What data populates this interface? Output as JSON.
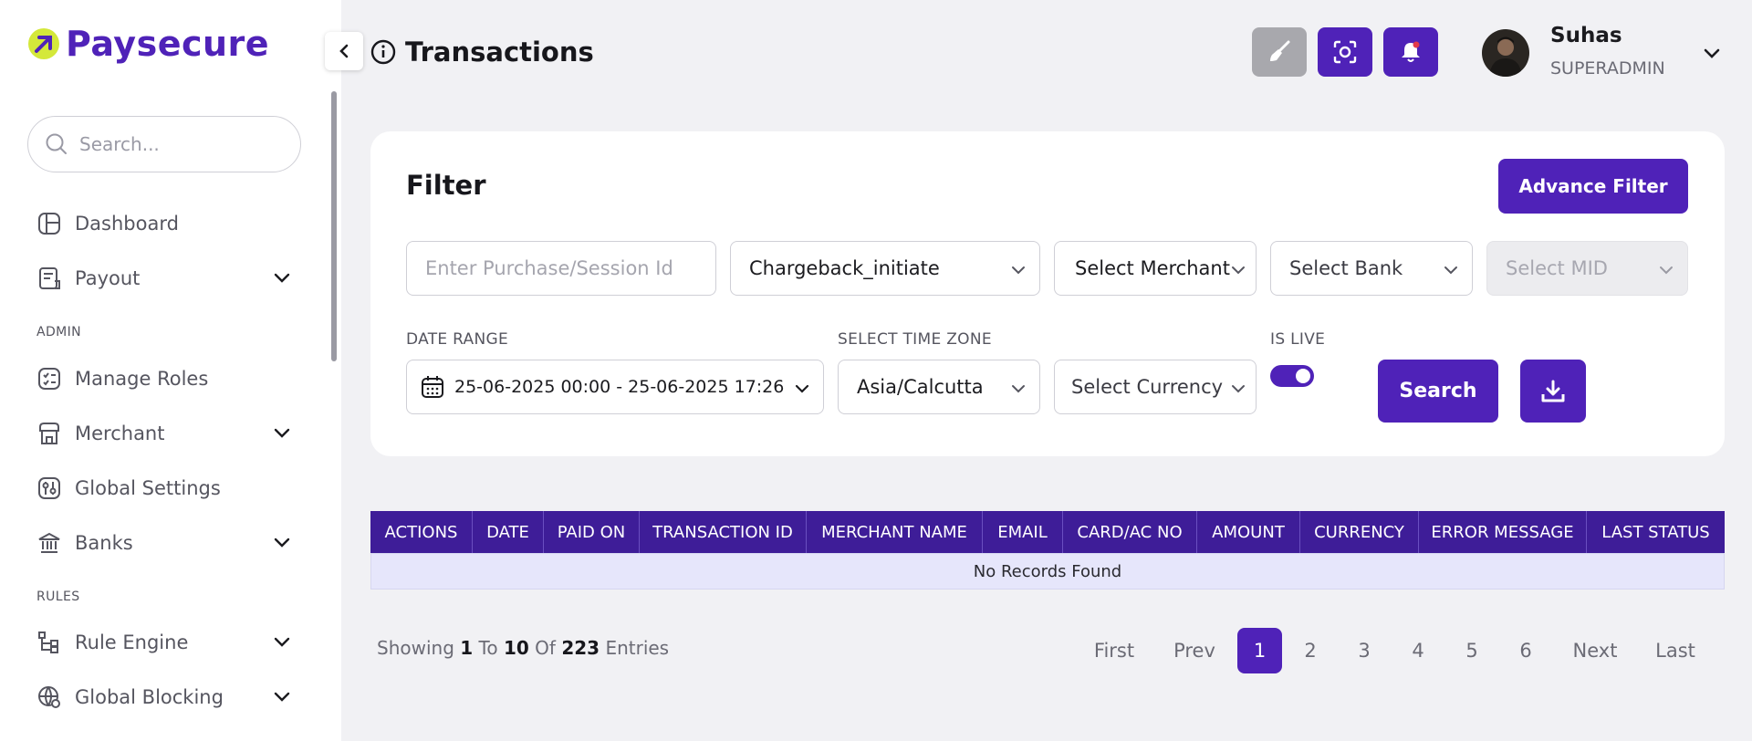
{
  "brand": {
    "name": "Paysecure",
    "accent": "#4f22b8",
    "logo_mark_color": "#d4e83a"
  },
  "sidebar": {
    "search_placeholder": "Search...",
    "items": [
      {
        "label": "Dashboard",
        "icon": "dashboard-icon",
        "expandable": false
      },
      {
        "label": "Payout",
        "icon": "payout-icon",
        "expandable": true
      },
      {
        "label": "Manage Roles",
        "icon": "roles-icon",
        "expandable": false
      },
      {
        "label": "Merchant",
        "icon": "merchant-icon",
        "expandable": true
      },
      {
        "label": "Global Settings",
        "icon": "settings-sliders-icon",
        "expandable": false
      },
      {
        "label": "Banks",
        "icon": "bank-icon",
        "expandable": true
      },
      {
        "label": "Rule Engine",
        "icon": "rule-engine-icon",
        "expandable": true
      },
      {
        "label": "Global Blocking",
        "icon": "globe-block-icon",
        "expandable": true
      }
    ],
    "sections": {
      "admin": "ADMIN",
      "rules": "RULES"
    }
  },
  "header": {
    "title": "Transactions",
    "user": {
      "name": "Suhas",
      "role": "SUPERADMIN"
    }
  },
  "filter": {
    "title": "Filter",
    "advance_filter": "Advance Filter",
    "purchase_placeholder": "Enter Purchase/Session Id",
    "status_value": "Chargeback_initiate",
    "merchant_value": "Select Merchant",
    "bank_value": "Select Bank",
    "mid_value": "Select MID",
    "date_range_label": "DATE RANGE",
    "date_range_value": "25-06-2025 00:00 - 25-06-2025 17:26",
    "timezone_label": "SELECT TIME ZONE",
    "timezone_value": "Asia/Calcutta",
    "currency_value": "Select Currency",
    "is_live_label": "IS LIVE",
    "is_live": true,
    "search": "Search"
  },
  "table": {
    "columns": [
      "ACTIONS",
      "DATE",
      "PAID ON",
      "TRANSACTION ID",
      "MERCHANT NAME",
      "EMAIL",
      "CARD/AC NO",
      "AMOUNT",
      "CURRENCY",
      "ERROR MESSAGE",
      "LAST STATUS"
    ],
    "empty_message": "No Records Found"
  },
  "pagination": {
    "showing_prefix": "Showing",
    "from": "1",
    "to_word": "To",
    "to": "10",
    "of_word": "Of",
    "total": "223",
    "entries_word": "Entries",
    "first": "First",
    "prev": "Prev",
    "pages": [
      "1",
      "2",
      "3",
      "4",
      "5",
      "6"
    ],
    "current": "1",
    "next": "Next",
    "last": "Last"
  }
}
